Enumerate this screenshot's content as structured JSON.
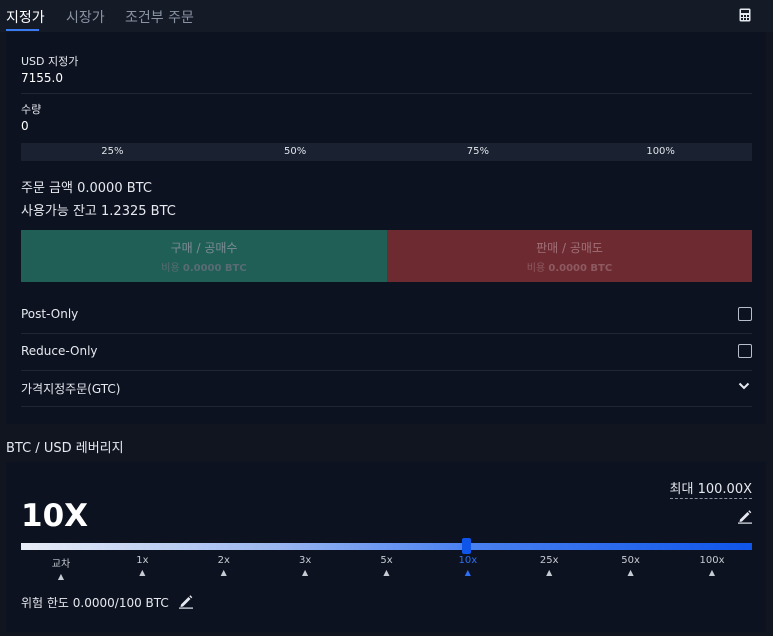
{
  "tabs": {
    "limit": "지정가",
    "market": "시장가",
    "conditional": "조건부 주문"
  },
  "order": {
    "price_label": "USD 지정가",
    "price_value": "7155.0",
    "qty_label": "수량",
    "qty_value": "0",
    "percents": [
      "25%",
      "50%",
      "75%",
      "100%"
    ],
    "order_amount": "주문 금액 0.0000 BTC",
    "available": "사용가능 잔고 1.2325 BTC",
    "buy_title": "구매 / 공매수",
    "buy_cost_label": "비용",
    "buy_cost_value": "0.0000 BTC",
    "sell_title": "판매 / 공매도",
    "sell_cost_label": "비용",
    "sell_cost_value": "0.0000 BTC",
    "post_only": "Post-Only",
    "reduce_only": "Reduce-Only",
    "time_in_force": "가격지정주문(GTC)"
  },
  "leverage": {
    "title": "BTC / USD 레버리지",
    "max": "최대 100.00X",
    "current": "10X",
    "ticks": [
      "교차",
      "1x",
      "2x",
      "3x",
      "5x",
      "10x",
      "25x",
      "50x",
      "100x"
    ],
    "active_tick": "10x",
    "risk_limit": "위험 한도 0.0000/100 BTC"
  },
  "colors": {
    "buy": "#1f5f56",
    "sell": "#6e2a31",
    "accent": "#3a7bf2",
    "slider_end": "#0f55ea"
  },
  "icons": [
    "calculator-icon",
    "chevron-down-icon",
    "pencil-icon"
  ]
}
